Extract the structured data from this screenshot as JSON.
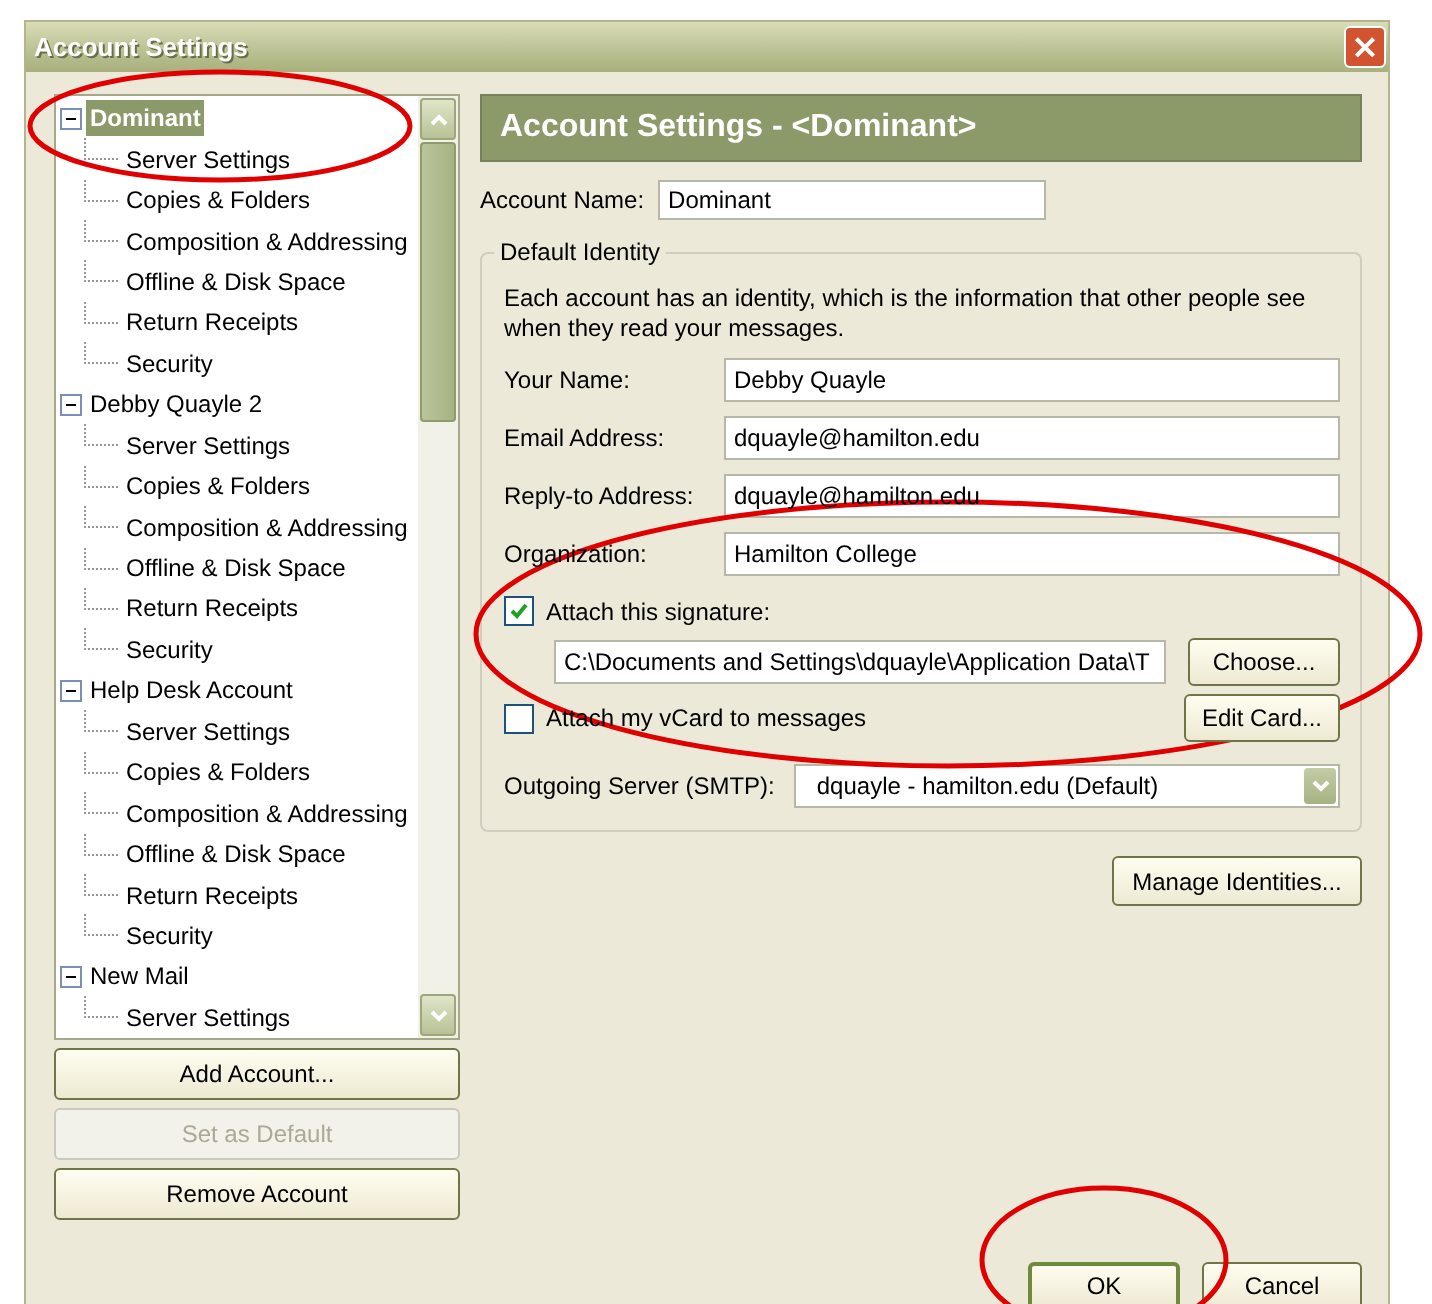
{
  "window": {
    "title": "Account Settings",
    "close": "×"
  },
  "tree": [
    {
      "label": "Dominant",
      "expanded": true,
      "selected": true,
      "children": [
        {
          "label": "Server Settings",
          "selected": false
        },
        {
          "label": "Copies & Folders",
          "selected": false
        },
        {
          "label": "Composition & Addressing",
          "selected": false
        },
        {
          "label": "Offline & Disk Space",
          "selected": false
        },
        {
          "label": "Return Receipts",
          "selected": false
        },
        {
          "label": "Security",
          "selected": false
        }
      ]
    },
    {
      "label": "Debby Quayle 2",
      "expanded": true,
      "selected": false,
      "children": [
        {
          "label": "Server Settings",
          "selected": false
        },
        {
          "label": "Copies & Folders",
          "selected": false
        },
        {
          "label": "Composition & Addressing",
          "selected": false
        },
        {
          "label": "Offline & Disk Space",
          "selected": false
        },
        {
          "label": "Return Receipts",
          "selected": false
        },
        {
          "label": "Security",
          "selected": false
        }
      ]
    },
    {
      "label": "Help Desk Account",
      "expanded": true,
      "selected": false,
      "children": [
        {
          "label": "Server Settings",
          "selected": false
        },
        {
          "label": "Copies & Folders",
          "selected": false
        },
        {
          "label": "Composition & Addressing",
          "selected": false
        },
        {
          "label": "Offline & Disk Space",
          "selected": false
        },
        {
          "label": "Return Receipts",
          "selected": false
        },
        {
          "label": "Security",
          "selected": false
        }
      ]
    },
    {
      "label": "New Mail",
      "expanded": true,
      "selected": false,
      "children": [
        {
          "label": "Server Settings",
          "selected": false
        }
      ]
    }
  ],
  "left_buttons": [
    {
      "label": "Add Account...",
      "disabled": false
    },
    {
      "label": "Set as Default",
      "disabled": true
    },
    {
      "label": "Remove Account",
      "disabled": false
    }
  ],
  "header": "Account Settings - <Dominant>",
  "account_name": {
    "label": "Account Name:",
    "value": "Dominant"
  },
  "identity": {
    "legend": "Default Identity",
    "description": "Each account has an identity, which is the information that other people see when they read your messages.",
    "fields": [
      {
        "label": "Your Name:",
        "value": "Debby Quayle"
      },
      {
        "label": "Email Address:",
        "value": "dquayle@hamilton.edu"
      },
      {
        "label": "Reply-to Address:",
        "value": "dquayle@hamilton.edu"
      },
      {
        "label": "Organization:",
        "value": "Hamilton College"
      }
    ],
    "signature": {
      "label": "Attach this signature:",
      "checked": true,
      "path": "C:\\Documents and Settings\\dquayle\\Application Data\\T",
      "button": "Choose..."
    },
    "vcard": {
      "label": "Attach my vCard to messages",
      "checked": false,
      "button": "Edit Card..."
    },
    "smtp": {
      "label": "Outgoing Server (SMTP):",
      "value": "dquayle - hamilton.edu (Default)"
    }
  },
  "manage_button": "Manage Identities...",
  "dialog_buttons": [
    {
      "label": "OK",
      "default": true
    },
    {
      "label": "Cancel",
      "default": false
    }
  ]
}
